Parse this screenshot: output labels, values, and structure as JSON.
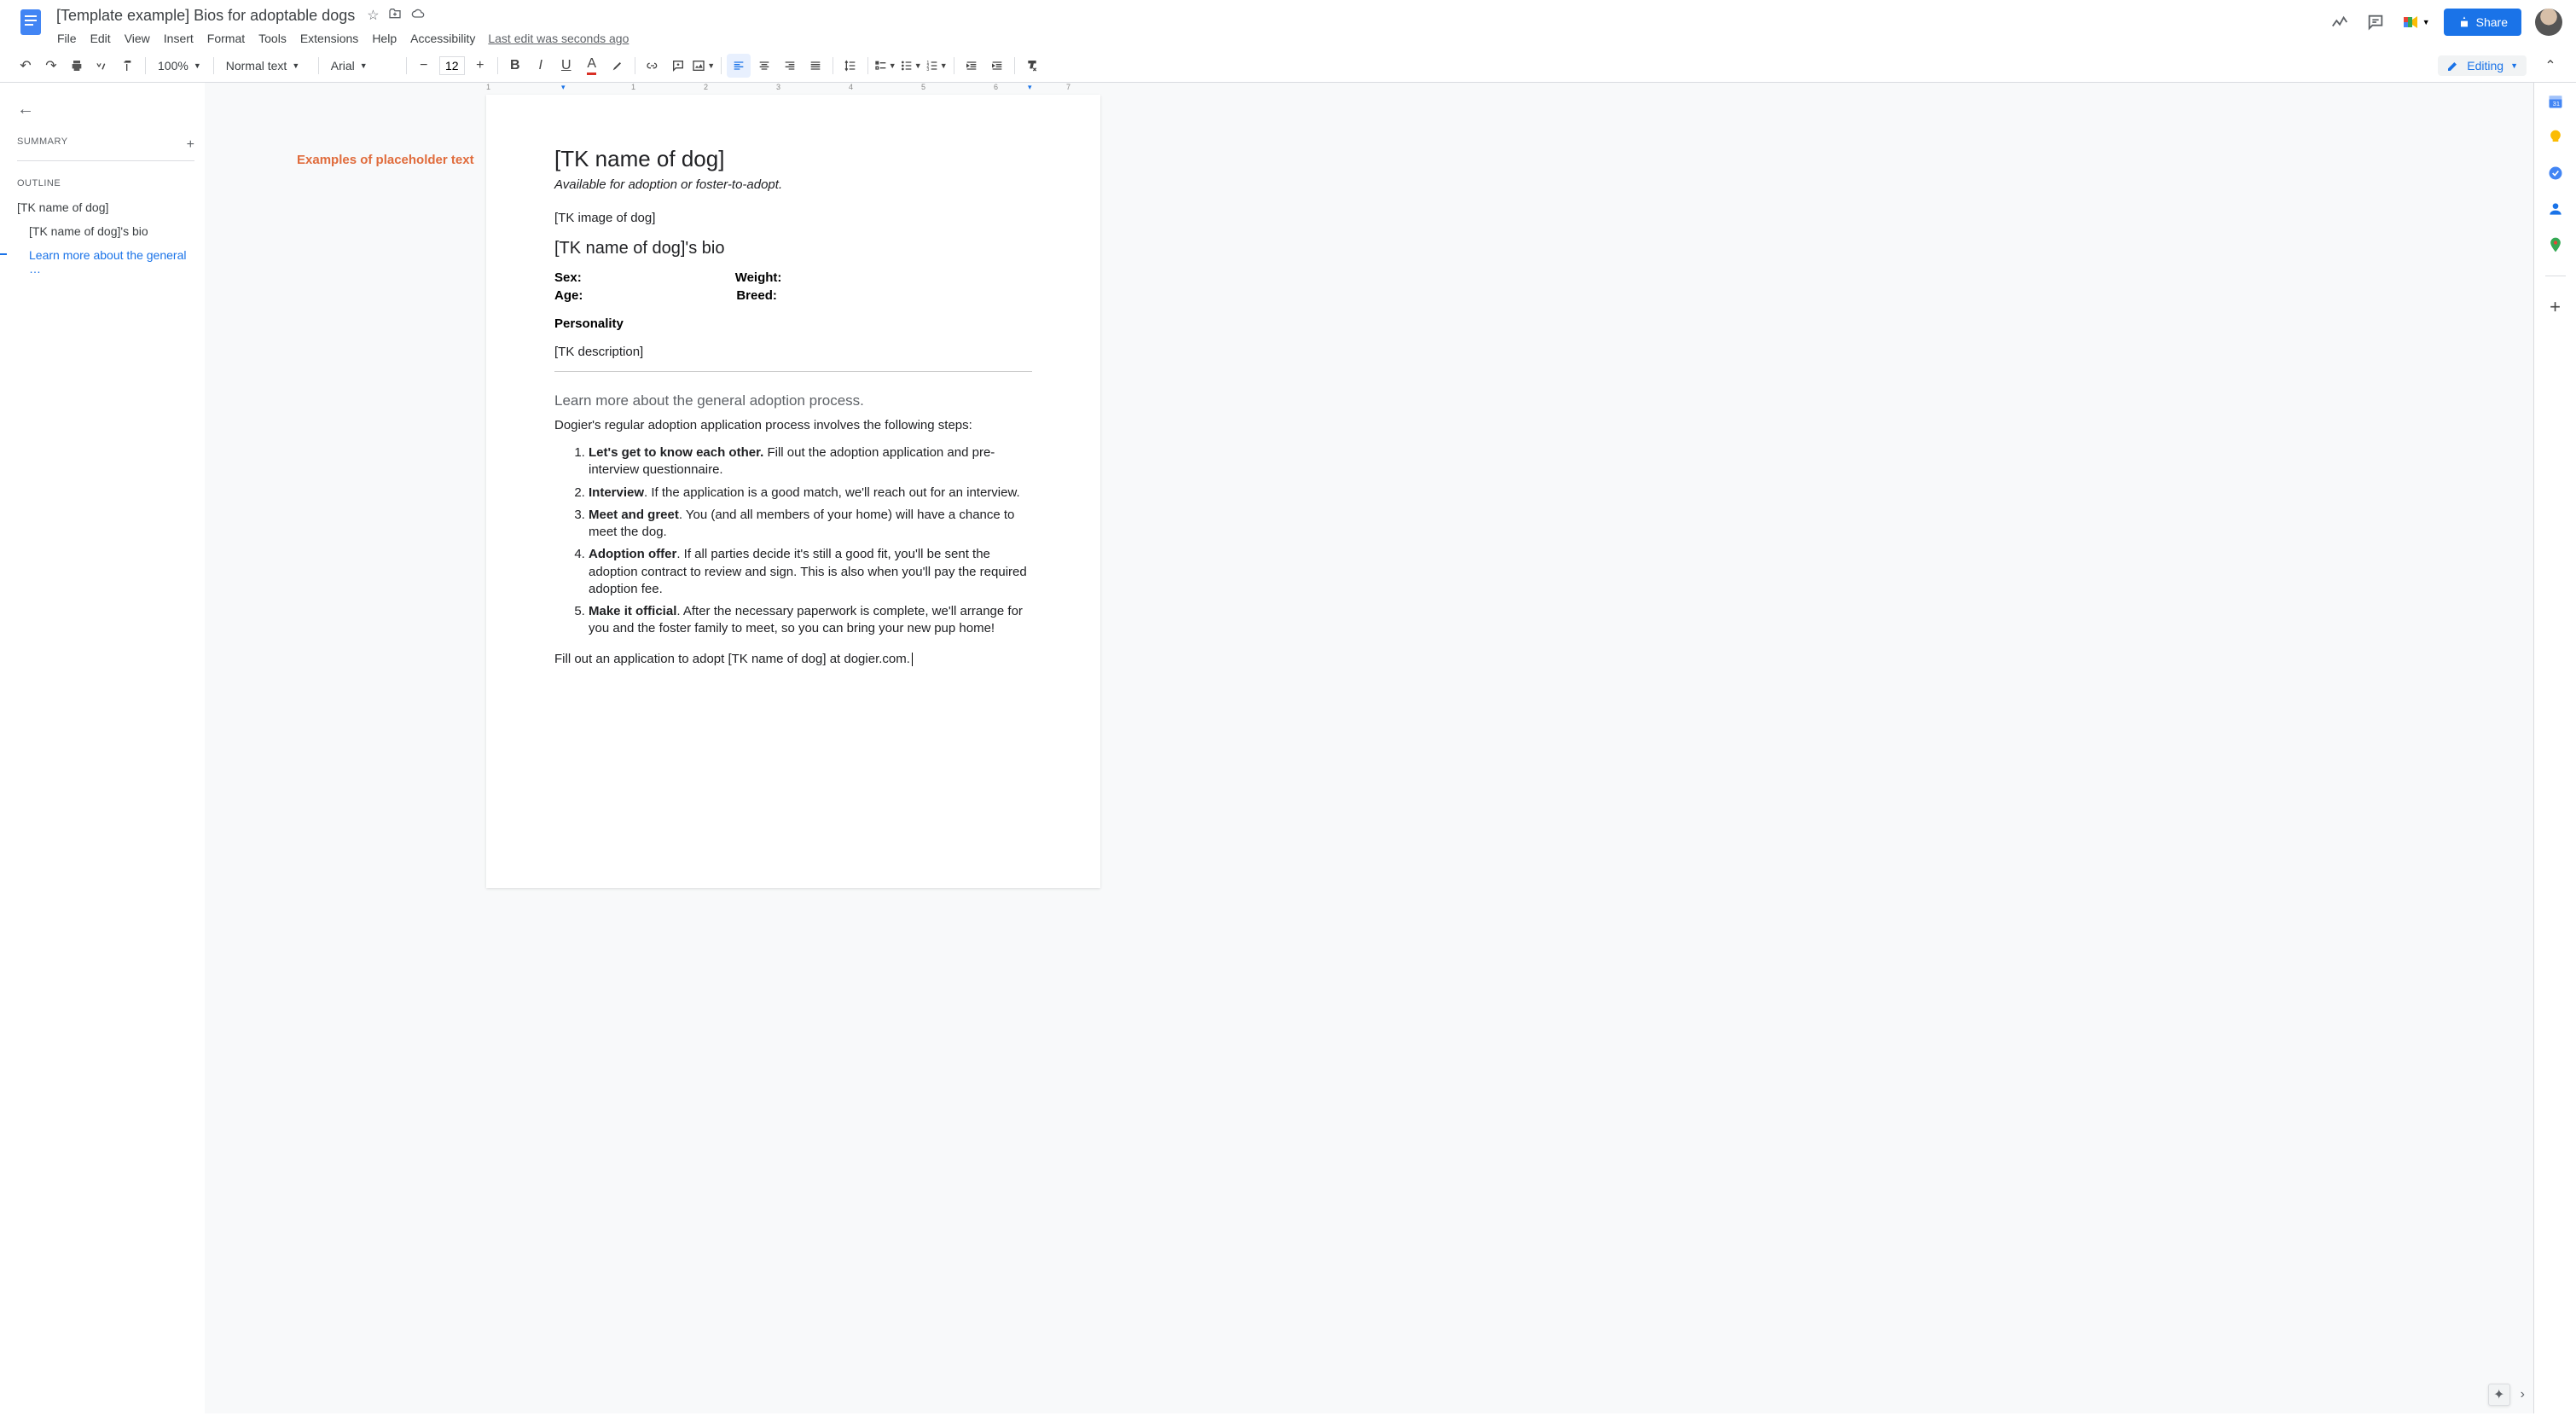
{
  "title": "[Template example] Bios for adoptable dogs",
  "last_edit": "Last edit was seconds ago",
  "menu": [
    "File",
    "Edit",
    "View",
    "Insert",
    "Format",
    "Tools",
    "Extensions",
    "Help",
    "Accessibility"
  ],
  "toolbar": {
    "zoom": "100%",
    "style": "Normal text",
    "font": "Arial",
    "size": "12",
    "mode": "Editing"
  },
  "share": "Share",
  "sidebar": {
    "summary": "SUMMARY",
    "outline": "OUTLINE",
    "items": [
      "[TK name of dog]",
      "[TK name of dog]'s bio",
      "Learn more about the general …"
    ]
  },
  "annotation": "Examples of placeholder text",
  "doc": {
    "h1": "[TK name of dog]",
    "subtitle": "Available for adoption or foster-to-adopt.",
    "img": "[TK image of dog]",
    "h2": "[TK name of dog]'s bio",
    "sex": "Sex:",
    "age": "Age:",
    "weight": "Weight:",
    "breed": "Breed:",
    "personality": "Personality",
    "desc": "[TK description]",
    "h3": "Learn more about the general adoption process.",
    "intro": "Dogier's regular adoption application process involves the following steps:",
    "steps": [
      {
        "b": "Let's get to know each other.",
        "t": " Fill out the adoption application and pre-interview questionnaire."
      },
      {
        "b": "Interview",
        "t": ". If the application is a good match, we'll reach out for an interview."
      },
      {
        "b": "Meet and greet",
        "t": ". You (and all members of your home) will have a chance to meet the dog."
      },
      {
        "b": "Adoption offer",
        "t": ". If all parties decide it's still a good fit, you'll be sent the adoption contract to review and sign. This is also when you'll pay the required adoption fee."
      },
      {
        "b": "Make it official",
        "t": ". After the necessary paperwork is complete, we'll arrange for you and the foster family to meet, so you can bring your new pup home!"
      }
    ],
    "outro": "Fill out an application to adopt [TK name of dog] at dogier.com."
  }
}
